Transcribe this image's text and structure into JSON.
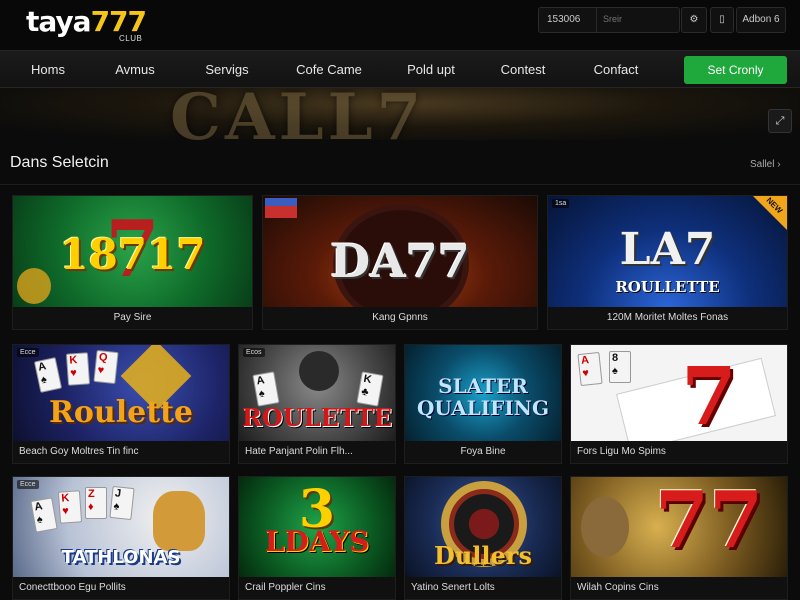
{
  "brand": {
    "logo_main": "taya",
    "logo_num": "777",
    "logo_sub": "CLUB"
  },
  "header": {
    "balance": "153006",
    "search_placeholder": "Sreir",
    "account": "Adbon 6"
  },
  "nav": {
    "items": [
      "Homs",
      "Avmus",
      "Servigs",
      "Cofe Came",
      "Pold upt",
      "Contest",
      "Confact"
    ],
    "cta": "Set Cronly"
  },
  "hero": {
    "word": "CALL7"
  },
  "section": {
    "title": "Dans Seletcin",
    "link": "Sallel ›"
  },
  "games": [
    {
      "art": "18717",
      "caption": "Pay Sire"
    },
    {
      "art": "DA77",
      "caption": "Kang Gpnns"
    },
    {
      "art": "LA7",
      "art_sub": "ROULLETTE",
      "caption": "120M Moritet Moltes Fonas",
      "corner": "NEW",
      "badge": "1sa"
    },
    {
      "art": "Roulette",
      "caption": "Beach Goy Moltres Tin finc",
      "badge": "Ecce"
    },
    {
      "art": "ROULETTE",
      "caption": "Hate Panjant Polin Flh...",
      "badge": "Ecos"
    },
    {
      "art": "SLATER QUALIFING",
      "caption": "Foya Bine",
      "badge": ""
    },
    {
      "art": "7",
      "caption": "Fors Ligu Mo Spims"
    },
    {
      "art": "TATHLONAS",
      "caption": "Conecttbooo Egu Pollits",
      "badge": "Ecce"
    },
    {
      "art": "LDAYS",
      "caption": "Crail Poppler Cins"
    },
    {
      "art": "Dullers",
      "caption": "Yatino Senert Lolts"
    },
    {
      "art": "77",
      "caption": "Wilah Copins Cins"
    }
  ],
  "colors": {
    "accent_green": "#1fa83c",
    "gold": "#f5c518"
  }
}
